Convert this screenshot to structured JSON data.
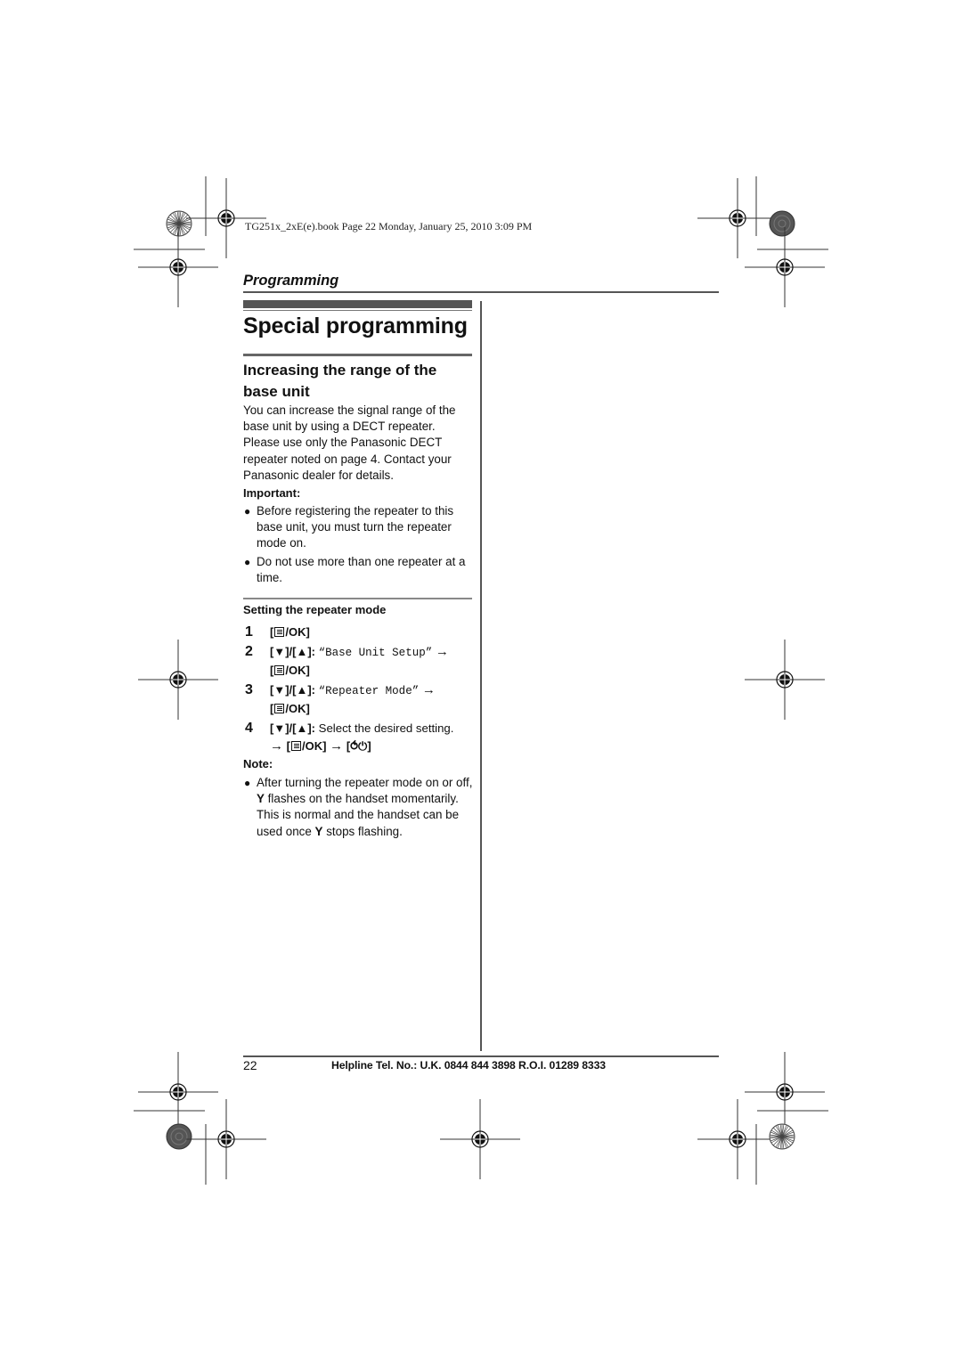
{
  "print_header": {
    "file_info": "TG251x_2xE(e).book  Page 22  Monday, January 25, 2010  3:09 PM"
  },
  "running_head": "Programming",
  "page_title": "Special programming",
  "section": {
    "title": "Increasing the range of the base unit",
    "intro": "You can increase the signal range of the base unit by using a DECT repeater. Please use only the Panasonic DECT repeater noted on page 4. Contact your Panasonic dealer for details.",
    "important_label": "Important:",
    "important_items": [
      "Before registering the repeater to this base unit, you must turn the repeater mode on.",
      "Do not use more than one repeater at a time."
    ],
    "procedure_title": "Setting the repeater mode",
    "steps": [
      {
        "num": "1",
        "key": "/OK",
        "text": ""
      },
      {
        "num": "2",
        "nav": "[▼]/[▲]:",
        "menu": "“Base Unit Setup”",
        "arrow": "→",
        "key": "/OK"
      },
      {
        "num": "3",
        "nav": "[▼]/[▲]:",
        "menu": "“Repeater Mode”",
        "arrow": "→",
        "key": "/OK"
      },
      {
        "num": "4",
        "nav": "[▼]/[▲]:",
        "text": "Select the desired setting.",
        "arrow": "→",
        "key": "/OK",
        "end_key": "⥀⏻"
      }
    ],
    "note_label": "Note:",
    "note_items": [
      {
        "pre": "After turning the repeater mode on or off,",
        "icon": "Υ",
        "mid": "flashes on the handset momentarily. This is normal and the handset can be used once",
        "icon2": "Υ",
        "post": "stops flashing."
      }
    ]
  },
  "footer": {
    "page_number": "22",
    "helpline": "Helpline Tel. No.: U.K. 0844 844 3898 R.O.I. 01289 8333"
  },
  "icons": {
    "bullet": "●",
    "bracket_open": "[",
    "bracket_close": "]"
  }
}
